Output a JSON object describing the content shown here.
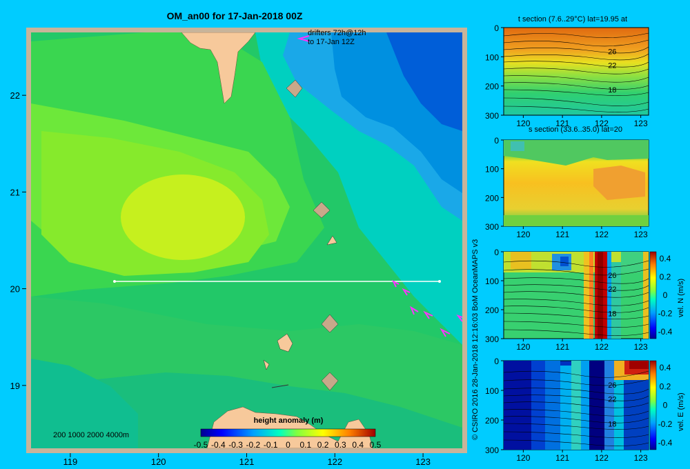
{
  "main_title": "OM_an00 for 17-Jan-2018 00Z",
  "drifters": {
    "line1": "drifters 72h@12h",
    "line2": "to 17-Jan 12Z"
  },
  "depth_legend": "200  1000  2000  4000m",
  "colorbar": {
    "title": "height anomaly (m)",
    "ticks": [
      "-0.5",
      "-0.4",
      "-0.3",
      "-0.2",
      "-0.1",
      "0",
      "0.1",
      "0.2",
      "0.3",
      "0.4",
      "0.5"
    ]
  },
  "credit": "© CSIRO 2016   28-Jan-2018 12:16:03 BoM OceanMAPS v3",
  "colors": {
    "background": "#00ccff",
    "land": "#f7c99b",
    "section_line": "#ffffff",
    "drifter": "#ff33ff"
  },
  "chart_data": [
    {
      "type": "heatmap",
      "title": "OM_an00 for 17-Jan-2018 00Z",
      "xlabel": "",
      "ylabel": "",
      "xlim": [
        118.5,
        123.5
      ],
      "ylim": [
        18.3,
        22.7
      ],
      "x_ticks": [
        "119",
        "120",
        "121",
        "122",
        "123"
      ],
      "y_ticks": [
        "19",
        "20",
        "21",
        "22"
      ],
      "variable": "height anomaly (m)",
      "value_range": [
        -0.5,
        0.5
      ],
      "section_line": {
        "lat": 20,
        "lon_start": 119.5,
        "lon_end": 123.2
      },
      "anomaly_regions": [
        {
          "lon": 120.0,
          "lat": 20.8,
          "value": 0.18
        },
        {
          "lon": 120.0,
          "lat": 20.8,
          "value": 0.12
        },
        {
          "lon": 122.9,
          "lat": 22.2,
          "value": -0.25
        },
        {
          "lon": 121.5,
          "lat": 18.7,
          "value": 0.0
        }
      ]
    },
    {
      "type": "heatmap",
      "title": "t section (7.6..29°C) lat=19.95 at",
      "xlim": [
        119.5,
        123.2
      ],
      "ylim": [
        300,
        0
      ],
      "x_ticks": [
        "120",
        "121",
        "122",
        "123"
      ],
      "y_ticks": [
        "0",
        "100",
        "200",
        "300"
      ],
      "contour_labels": [
        "26",
        "22",
        "18"
      ]
    },
    {
      "type": "heatmap",
      "title": "s section (33.6..35.0) lat=20",
      "xlim": [
        119.5,
        123.2
      ],
      "ylim": [
        300,
        0
      ],
      "x_ticks": [
        "120",
        "121",
        "122",
        "123"
      ],
      "y_ticks": [
        "0",
        "100",
        "200",
        "300"
      ]
    },
    {
      "type": "heatmap",
      "title": "",
      "xlim": [
        119.5,
        123.2
      ],
      "ylim": [
        300,
        0
      ],
      "x_ticks": [
        "120",
        "121",
        "122",
        "123"
      ],
      "y_ticks": [
        "0",
        "100",
        "200",
        "300"
      ],
      "contour_labels": [
        "26",
        "22",
        "18"
      ],
      "colorbar_label": "vel. N (m/s)",
      "colorbar_ticks": [
        "0.4",
        "0.2",
        "0",
        "-0.2",
        "-0.4"
      ]
    },
    {
      "type": "heatmap",
      "title": "",
      "xlim": [
        119.5,
        123.2
      ],
      "ylim": [
        300,
        0
      ],
      "x_ticks": [
        "120",
        "121",
        "122",
        "123"
      ],
      "y_ticks": [
        "0",
        "100",
        "200",
        "300"
      ],
      "contour_labels": [
        "26",
        "22",
        "18"
      ],
      "colorbar_label": "vel. E (m/s)",
      "colorbar_ticks": [
        "0.4",
        "0.2",
        "0",
        "-0.2",
        "-0.4"
      ]
    }
  ]
}
